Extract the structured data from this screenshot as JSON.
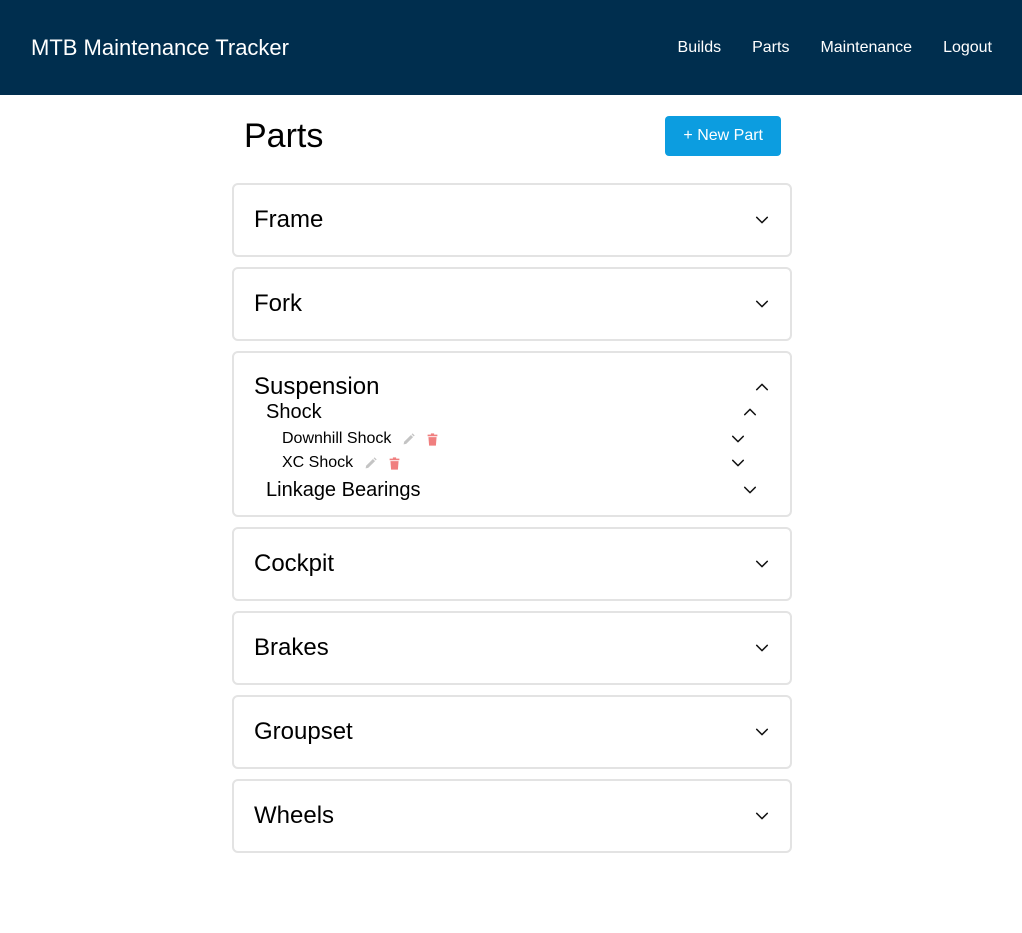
{
  "header": {
    "brand": "MTB Maintenance Tracker",
    "nav": [
      "Builds",
      "Parts",
      "Maintenance",
      "Logout"
    ]
  },
  "page": {
    "title": "Parts",
    "new_part_label": "+ New Part"
  },
  "categories": {
    "frame": "Frame",
    "fork": "Fork",
    "suspension": {
      "title": "Suspension",
      "shock": {
        "title": "Shock",
        "items": [
          "Downhill Shock",
          "XC Shock"
        ]
      },
      "linkage": "Linkage Bearings"
    },
    "cockpit": "Cockpit",
    "brakes": "Brakes",
    "groupset": "Groupset",
    "wheels": "Wheels"
  },
  "colors": {
    "navbar": "#002e4e",
    "accent": "#0c9de0",
    "delete": "#f07f7f",
    "edit": "#c4c4c4"
  }
}
